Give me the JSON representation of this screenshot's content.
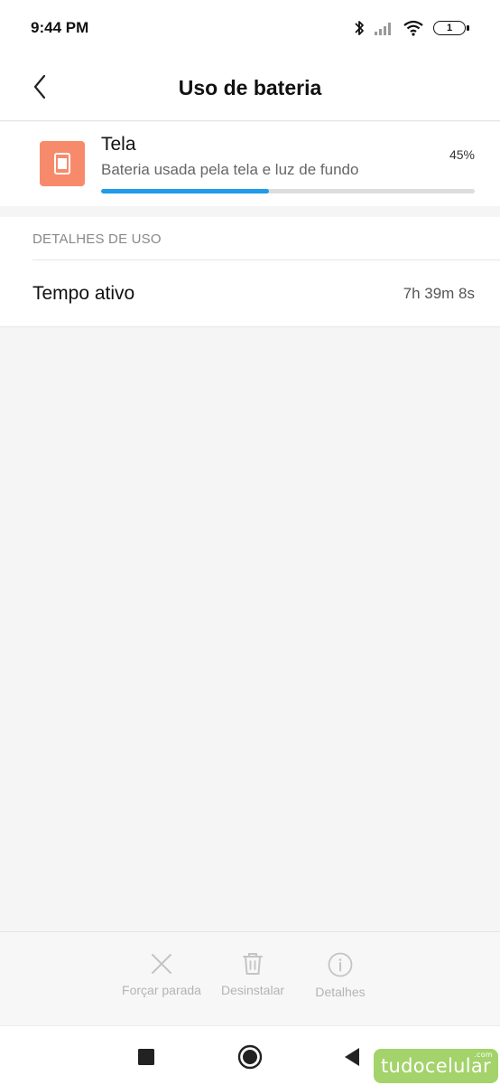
{
  "status_bar": {
    "time": "9:44 PM",
    "battery_level": "1",
    "icons": [
      "bluetooth-icon",
      "signal-icon",
      "wifi-icon",
      "battery-icon"
    ]
  },
  "header": {
    "title": "Uso de bateria",
    "back_icon": "chevron-left-icon"
  },
  "usage": {
    "name": "Tela",
    "description": "Bateria usada pela tela e luz de fundo",
    "percent_label": "45%",
    "percent_value": 45,
    "icon": "tablet-screen-icon",
    "icon_color": "#f88a6c",
    "progress_color": "#1e9be9"
  },
  "details": {
    "section_title": "DETALHES DE USO",
    "rows": [
      {
        "label": "Tempo ativo",
        "value": "7h 39m 8s"
      }
    ]
  },
  "actions": [
    {
      "label": "Forçar parada",
      "icon": "close-icon"
    },
    {
      "label": "Desinstalar",
      "icon": "trash-icon"
    },
    {
      "label": "Detalhes",
      "icon": "info-icon"
    }
  ],
  "navigation": {
    "buttons": [
      "recents-square-icon",
      "home-circle-icon",
      "back-triangle-icon"
    ]
  },
  "watermark": {
    "text": "tudocelular",
    "superscript": ".com",
    "color": "#a3d36a"
  }
}
